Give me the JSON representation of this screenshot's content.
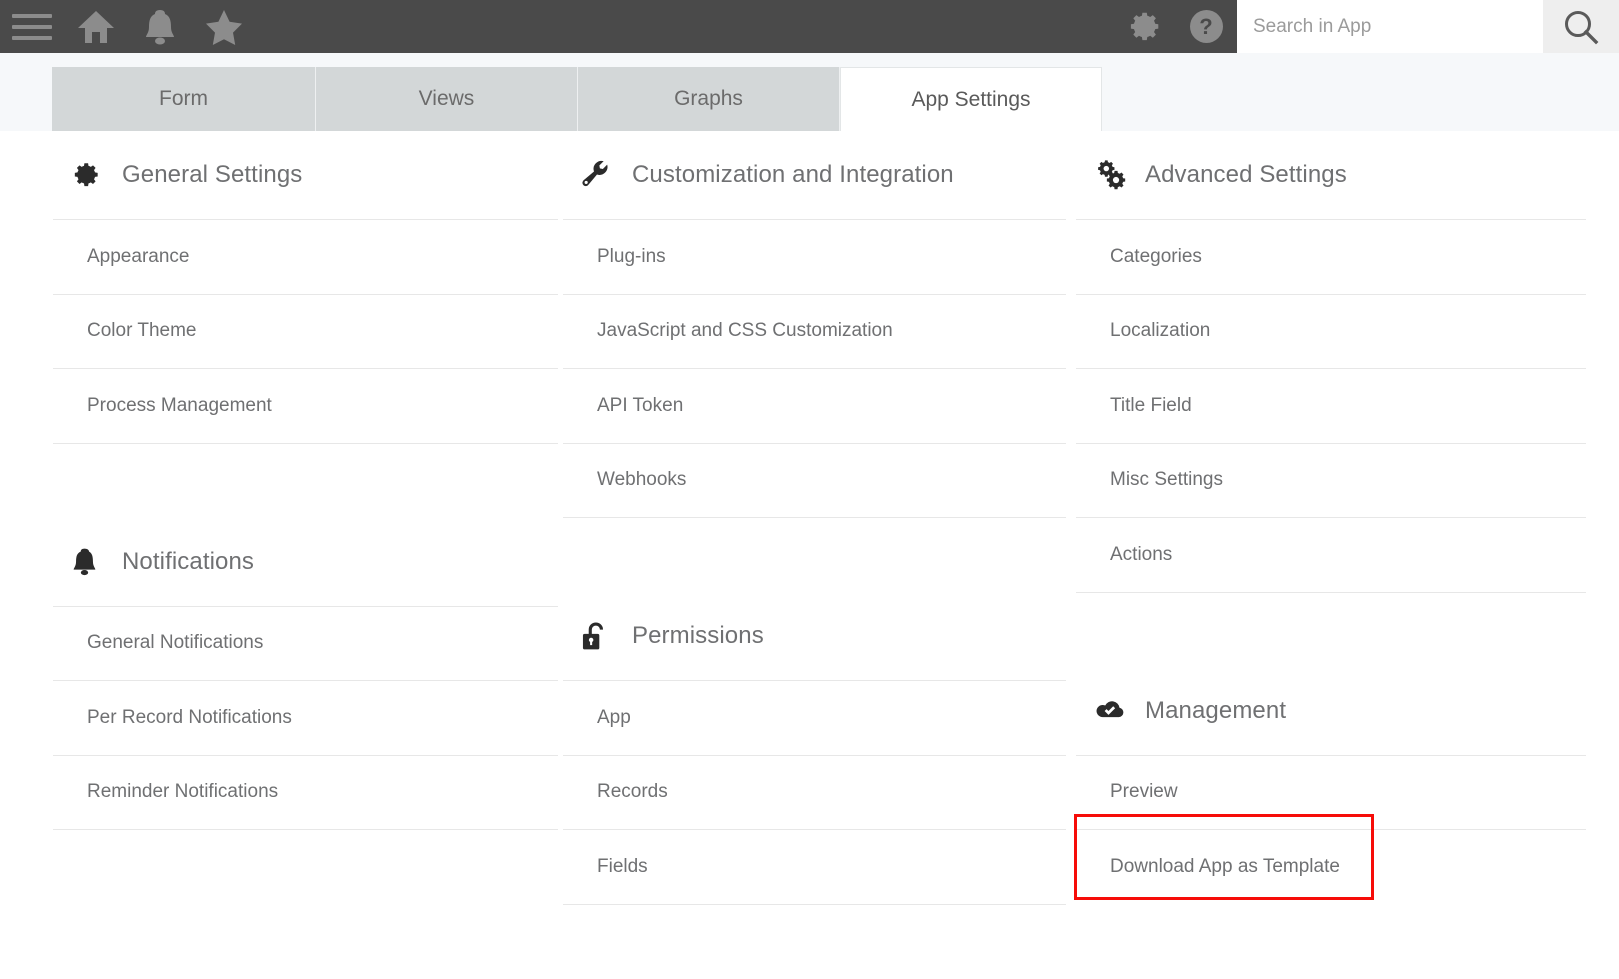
{
  "topbar": {
    "menu_icon": "hamburger-icon",
    "home_icon": "home-icon",
    "bell_icon": "bell-icon",
    "star_icon": "star-icon",
    "gear_icon": "gear-icon",
    "help_icon": "help-icon",
    "help_label": "?",
    "search_placeholder": "Search in App",
    "search_value": "",
    "search_icon": "search-icon",
    "background_color": "#4a4a4a"
  },
  "tabs": [
    {
      "label": "Form",
      "active": false
    },
    {
      "label": "Views",
      "active": false
    },
    {
      "label": "Graphs",
      "active": false
    },
    {
      "label": "App Settings",
      "active": true
    }
  ],
  "highlight_color": "#f60c08",
  "columns": [
    {
      "groups": [
        {
          "title": "General Settings",
          "icon": "gear-icon",
          "items": [
            "Appearance",
            "Color Theme",
            "Process Management"
          ]
        },
        {
          "title": "Notifications",
          "icon": "bell-icon",
          "items": [
            "General Notifications",
            "Per Record Notifications",
            "Reminder Notifications"
          ]
        }
      ]
    },
    {
      "groups": [
        {
          "title": "Customization and Integration",
          "icon": "wrench-icon",
          "items": [
            "Plug-ins",
            "JavaScript and CSS Customization",
            "API Token",
            "Webhooks"
          ]
        },
        {
          "title": "Permissions",
          "icon": "unlock-icon",
          "items": [
            "App",
            "Records",
            "Fields"
          ]
        }
      ]
    },
    {
      "groups": [
        {
          "title": "Advanced Settings",
          "icon": "double-gear-icon",
          "items": [
            "Categories",
            "Localization",
            "Title Field",
            "Misc Settings",
            "Actions"
          ]
        },
        {
          "title": "Management",
          "icon": "cloud-check-icon",
          "items": [
            "Preview",
            "Download App as Template"
          ]
        }
      ]
    }
  ]
}
